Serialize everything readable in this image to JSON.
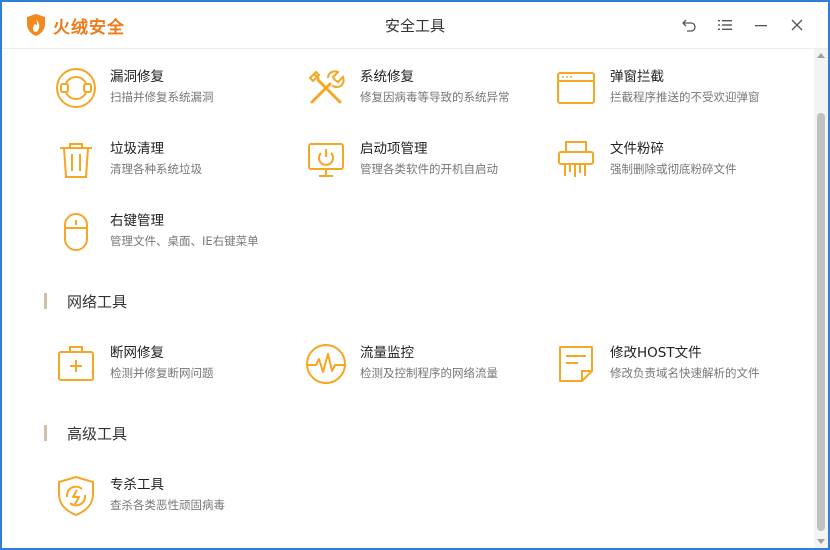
{
  "app": {
    "brand": "火绒安全",
    "window_title": "安全工具"
  },
  "colors": {
    "accent": "#f5a623",
    "brand": "#ee7a1a",
    "window_border": "#2f7fd6"
  },
  "tools": {
    "vuln_repair": {
      "name": "漏洞修复",
      "desc": "扫描并修复系统漏洞",
      "icon": "vulnerability-icon"
    },
    "system_repair": {
      "name": "系统修复",
      "desc": "修复因病毒等导致的系统异常",
      "icon": "wrench-tools-icon"
    },
    "popup_block": {
      "name": "弹窗拦截",
      "desc": "拦截程序推送的不受欢迎弹窗",
      "icon": "popup-window-icon"
    },
    "junk_clean": {
      "name": "垃圾清理",
      "desc": "清理各种系统垃圾",
      "icon": "trash-icon"
    },
    "startup_mgmt": {
      "name": "启动项管理",
      "desc": "管理各类软件的开机自启动",
      "icon": "monitor-power-icon"
    },
    "file_shred": {
      "name": "文件粉碎",
      "desc": "强制删除或彻底粉碎文件",
      "icon": "shredder-icon"
    },
    "context_menu": {
      "name": "右键管理",
      "desc": "管理文件、桌面、IE右键菜单",
      "icon": "mouse-icon"
    },
    "net_repair": {
      "name": "断网修复",
      "desc": "检测并修复断网问题",
      "icon": "first-aid-kit-icon"
    },
    "traffic_monitor": {
      "name": "流量监控",
      "desc": "检测及控制程序的网络流量",
      "icon": "pulse-gauge-icon"
    },
    "host_edit": {
      "name": "修改HOST文件",
      "desc": "修改负责域名快速解析的文件",
      "icon": "document-icon"
    },
    "special_kill": {
      "name": "专杀工具",
      "desc": "查杀各类恶性顽固病毒",
      "icon": "shield-bolt-icon"
    }
  },
  "sections": {
    "network": "网络工具",
    "advanced": "高级工具"
  }
}
